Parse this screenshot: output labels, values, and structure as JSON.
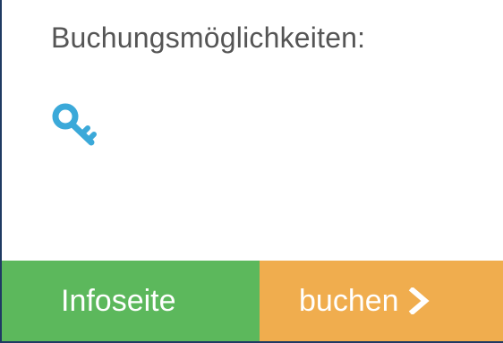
{
  "booking": {
    "heading": "Buchungsmöglichkeiten:",
    "options": [
      {
        "icon": "key-icon"
      }
    ]
  },
  "actions": {
    "info_label": "Infoseite",
    "book_label": "buchen",
    "book_icon": "chevron-right-icon"
  },
  "colors": {
    "info_button": "#5cb85c",
    "book_button": "#f0ad4e",
    "icon": "#3ba9d9",
    "text": "#555555",
    "border": "#1f3a63"
  }
}
